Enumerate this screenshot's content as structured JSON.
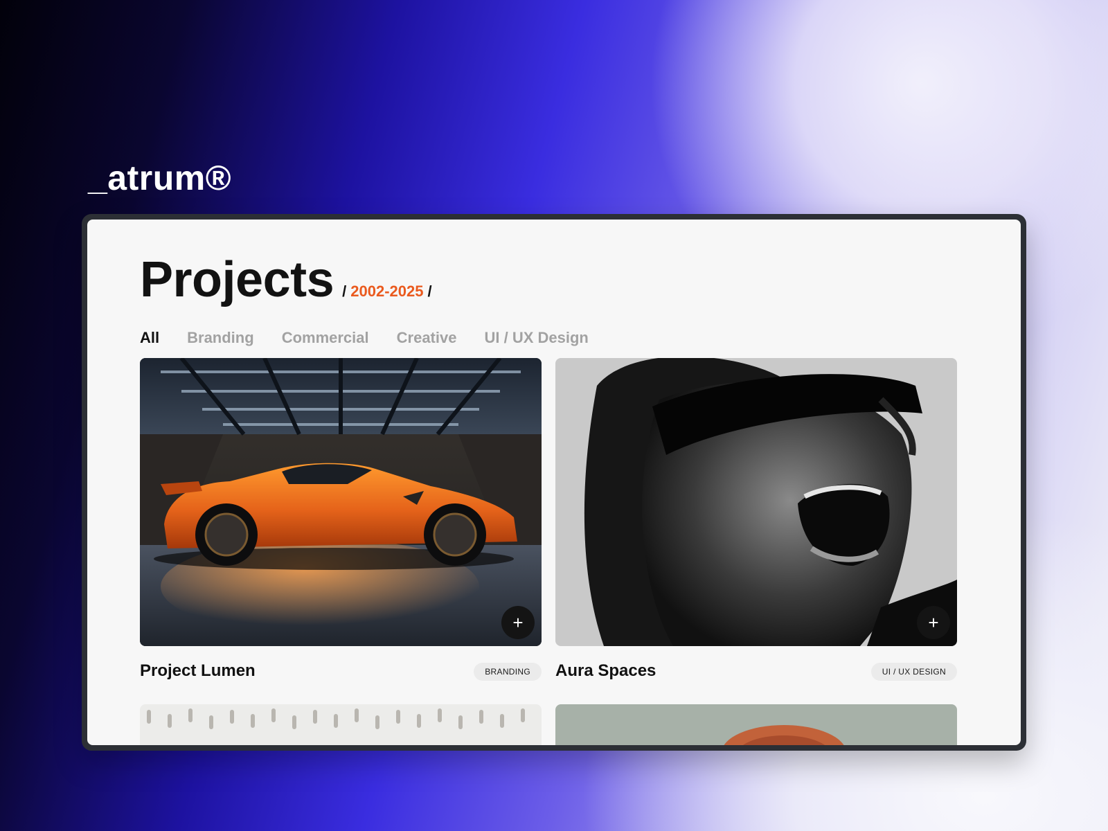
{
  "brand": {
    "logo": "_atrum®"
  },
  "page": {
    "title": "Projects",
    "period": {
      "open": "/",
      "years": "2002-2025",
      "close": "/"
    },
    "accent_color": "#ea5a1e"
  },
  "filters": {
    "active": "All",
    "items": [
      "All",
      "Branding",
      "Commercial",
      "Creative",
      "UI / UX Design"
    ]
  },
  "projects": [
    {
      "name": "Project Lumen",
      "tag": "BRANDING",
      "image": "orange sports car in studio garage",
      "action_icon": "plus-icon",
      "action_label": "+"
    },
    {
      "name": "Aura Spaces",
      "tag": "UI / UX DESIGN",
      "image": "black and white portrait with sunglasses",
      "action_icon": "plus-icon",
      "action_label": "+"
    },
    {
      "image": "white knit texture"
    },
    {
      "image": "portrait with red hair"
    }
  ]
}
